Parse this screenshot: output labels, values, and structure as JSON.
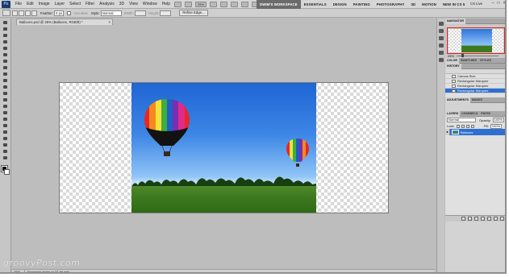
{
  "menubar": {
    "logo": "Ps",
    "items": [
      "File",
      "Edit",
      "Image",
      "Layer",
      "Select",
      "Filter",
      "Analysis",
      "3D",
      "View",
      "Window",
      "Help"
    ],
    "icons": [
      "bridge-icon",
      "minibridge-icon",
      "zoom-level-icon",
      "hand-icon",
      "zoom-tool-icon",
      "rotate-icon",
      "arrange-icon",
      "screen-mode-icon"
    ],
    "zoom_level": "25%",
    "workspaces": [
      "DWIM'S WORKSPACE",
      "ESSENTIALS",
      "DESIGN",
      "PAINTING",
      "PHOTOGRAPHY",
      "3D",
      "MOTION",
      "NEW IN CS 5"
    ],
    "cs_live": "CS Live",
    "window_controls": [
      "–",
      "□",
      "×"
    ]
  },
  "options": {
    "feather_label": "Feather:",
    "feather_value": "0 px",
    "antialias_label": "Anti-alias",
    "style_label": "Style:",
    "style_value": "Normal",
    "width_label": "Width:",
    "height_label": "Height:",
    "refine_edge": "Refine Edge..."
  },
  "document": {
    "tab_title": "Balloons.psd @ 25% (Balloons, RGB/8) *",
    "close": "×"
  },
  "statusbar": {
    "zoom": "25%",
    "info": "Exposure works in 32-bit only"
  },
  "navigator": {
    "tab": "NAVIGATOR",
    "zoom": "25%"
  },
  "panel_group2": {
    "tabs": [
      "COLOR",
      "SWATCHES",
      "STYLES"
    ]
  },
  "history": {
    "tab": "HISTORY",
    "items": [
      "Canvas Size",
      "Rectangular Marquee",
      "Rectangular Marquee",
      "Rectangular Marquee"
    ],
    "selected_index": 3
  },
  "adjustments": {
    "tabs": [
      "ADJUSTMENTS",
      "MASKS"
    ]
  },
  "layers": {
    "tabs": [
      "LAYERS",
      "CHANNELS",
      "PATHS"
    ],
    "blend_mode": "Normal",
    "opacity_label": "Opacity:",
    "opacity_value": "100%",
    "lock_label": "Lock:",
    "fill_label": "Fill:",
    "fill_value": "100%",
    "layer_name": "Balloons"
  },
  "watermark": "groovyPost.com",
  "colors": {
    "sky_top": "#1f65d4",
    "field": "#3d7a1f",
    "selection_blue": "#2f6fd0",
    "active_workspace": "#6b6b6b"
  }
}
